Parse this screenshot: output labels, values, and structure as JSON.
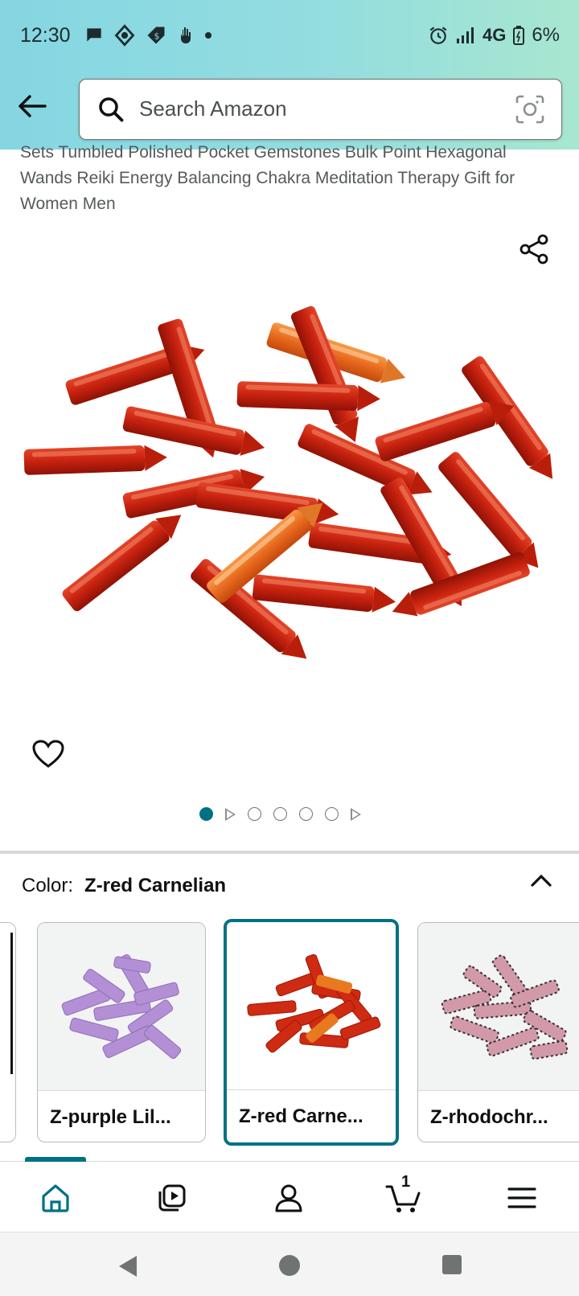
{
  "status_bar": {
    "time": "12:30",
    "network": "4G",
    "battery": "6%"
  },
  "header": {
    "search_placeholder": "Search Amazon"
  },
  "product": {
    "title": "Sets Tumbled Polished Pocket Gemstones Bulk Point Hexagonal Wands Reiki Energy Balancing Chakra Meditation Therapy Gift for Women Men"
  },
  "carousel": {
    "active_index": 0,
    "total": 7
  },
  "color_selector": {
    "label": "Color:",
    "selected": "Z-red Carnelian",
    "options": [
      {
        "label": "Z-purple Lil..."
      },
      {
        "label": "Z-red Carne..."
      },
      {
        "label": "Z-rhodochr..."
      }
    ]
  },
  "bottom_nav": {
    "items": [
      "home-icon",
      "video-icon",
      "account-icon",
      "cart-icon",
      "menu-icon"
    ],
    "cart_count": "1",
    "accent_color": "#007185"
  }
}
